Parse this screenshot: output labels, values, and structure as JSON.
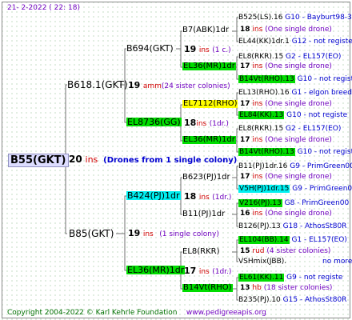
{
  "header": {
    "date": "21-   2-2022 (  22: 18)"
  },
  "footer": {
    "copyright": "Copyright 2004-2022 © Karl Kehrle Foundation",
    "site": "www.pedigreeapis.org"
  },
  "root": {
    "name": "B55(GKT)",
    "gen": "20",
    "ins": "ins",
    "note": "(Drones from 1 single colony)"
  },
  "sire": {
    "name": "B618.1(GKT)",
    "gen": "19",
    "amm": "amm",
    "note": "(24 sister colonies)"
  },
  "dam": {
    "name": "B85(GKT)",
    "gen": "19",
    "ins": "ins",
    "note": "(1 single colony)"
  },
  "gen3": [
    {
      "name": "B694(GKT)",
      "gen": "19",
      "ins": "ins",
      "note": "(1 c.)"
    },
    {
      "name": "EL8736(GG)",
      "gen": "18",
      "ins": "ins",
      "note": "(1dr.)"
    },
    {
      "name": "B424(PJ)1dr",
      "gen": "18",
      "ins": "ins",
      "note": "(1dr.)"
    },
    {
      "name": "EL36(MR)1dr",
      "gen": "17",
      "ins": "ins",
      "note": "(1dr.)"
    }
  ],
  "gen4": [
    {
      "name": "B7(ABK)1dr",
      "gen": "18",
      "ins": "ins",
      "note": "(One single drone)"
    },
    {
      "name": "EL36(MR)1dr",
      "gen": "17",
      "ins": "ins",
      "note": "(One single drone)"
    },
    {
      "name": "EL7112(RHO)",
      "gen": "17",
      "ins": "ins",
      "note": "(One single drone)"
    },
    {
      "name": "EL36(MR)1dr",
      "gen": "17",
      "ins": "ins",
      "note": "(One single drone)"
    },
    {
      "name": "B623(PJ)1dr",
      "gen": "17",
      "ins": "ins",
      "note": "(One single drone)"
    },
    {
      "name": "B11(PJ)1dr",
      "gen": "16",
      "ins": "ins",
      "note": "(One single drone)"
    },
    {
      "name": "EL8(RKR)",
      "gen": "15",
      "ins": "rud",
      "note": "(4 sister colonies)"
    },
    {
      "name": "B14Vt(RHO)",
      "gen": "13",
      "ins": "hb",
      "note": "(18 sister colonies)"
    }
  ],
  "gen5": [
    {
      "name": "B525(LS).16",
      "note": "G10 - Bayburt98-3"
    },
    {
      "name": "EL44(KK)1dr.1",
      "note": "G12 - not registe"
    },
    {
      "name": "EL8(RKR).15",
      "note": "G2 - EL157(EO)"
    },
    {
      "name": "B14Vt(RHO).13",
      "note": "G10 - not registe"
    },
    {
      "name": "EL13(RHO).16",
      "note": "G1 - elgon breed"
    },
    {
      "name": "EL84(KK).13",
      "note": "G10 - not registe"
    },
    {
      "name": "EL8(RKR).15",
      "note": "G2 - EL157(EO)"
    },
    {
      "name": "B14Vt(RHO).13",
      "note": "G10 - not registe"
    },
    {
      "name": "B11(PJ)1dr.16",
      "note": "G9 - PrimGreen00"
    },
    {
      "name": "V5H(PJ)1dr.15",
      "note": "G9 - PrimGreen00"
    },
    {
      "name": "V216(PJ).13",
      "note": "G8 - PrimGreen00"
    },
    {
      "name": "B126(PJ).13",
      "note": "G18 - AthosSt80R"
    },
    {
      "name": "EL104(BB).14",
      "note": "G1 - EL157(EO)"
    },
    {
      "name": "VSHmix(JBB).",
      "note": "no more"
    },
    {
      "name": "EL61(KK).11",
      "note": "G9 - not registe"
    },
    {
      "name": "B235(PJ).10",
      "note": "G15 - AthosSt80R"
    }
  ],
  "colors": {
    "green": "#00dd00",
    "yellow": "#ffff00",
    "cyan": "#00f0f0",
    "root_bg": "#ddddff",
    "red": "#d00000",
    "purple": "#7000c0",
    "blue": "#0000d0"
  }
}
